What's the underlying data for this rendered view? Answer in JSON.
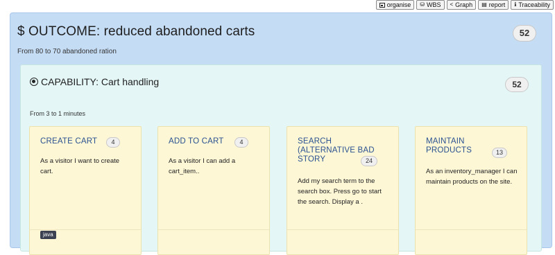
{
  "toolbar": {
    "buttons": [
      {
        "label": "organise",
        "icon": "layout-icon"
      },
      {
        "label": "WBS",
        "icon": "hierarchy-icon"
      },
      {
        "label": "Graph",
        "icon": "share-icon"
      },
      {
        "label": "report",
        "icon": "list-icon"
      },
      {
        "label": "Traceability",
        "icon": "info-icon"
      }
    ]
  },
  "outcome": {
    "title": "$ OUTCOME: reduced abandoned carts",
    "subtitle": "From 80 to 70 abandoned ration",
    "points": "52"
  },
  "capability": {
    "title": "CAPABILITY: Cart handling",
    "subtitle": "From 3 to 1 minutes",
    "points": "52"
  },
  "cards": [
    {
      "title": "CREATE CART",
      "points": "4",
      "body": "As a visitor I want to create cart.",
      "tag": "java"
    },
    {
      "title": "ADD TO CART",
      "points": "4",
      "body": "As a visitor I can add a cart_item..",
      "tag": ""
    },
    {
      "title": "SEARCH (ALTERNATIVE BAD STORY",
      "points": "24",
      "body": "Add my search term to the search box. Press go to start the search. Display a .",
      "tag": ""
    },
    {
      "title": "MAINTAIN PRODUCTS",
      "points": "13",
      "body": "As an inventory_manager I can maintain products on the site.",
      "tag": ""
    }
  ]
}
